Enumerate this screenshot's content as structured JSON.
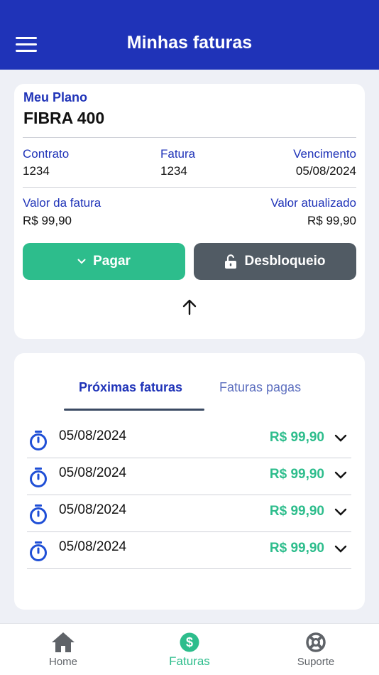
{
  "header": {
    "title": "Minhas faturas",
    "menu_icon": "menu-icon"
  },
  "plan": {
    "label": "Meu Plano",
    "name": "FIBRA 400",
    "contrato_label": "Contrato",
    "contrato_value": "1234",
    "fatura_label": "Fatura",
    "fatura_value": "1234",
    "vencimento_label": "Vencimento",
    "vencimento_value": "05/08/2024",
    "valor_label": "Valor da fatura",
    "valor_value": "R$ 99,90",
    "atualizado_label": "Valor atualizado",
    "atualizado_value": "R$ 99,90"
  },
  "actions": {
    "pagar_label": "Pagar",
    "desbloqueio_label": "Desbloqueio"
  },
  "tabs": {
    "active_label": "Próximas faturas",
    "inactive_label": "Faturas pagas"
  },
  "invoices": [
    {
      "date": "05/08/2024",
      "amount": "R$ 99,90"
    },
    {
      "date": "05/08/2024",
      "amount": "R$ 99,90"
    },
    {
      "date": "05/08/2024",
      "amount": "R$ 99,90"
    },
    {
      "date": "05/08/2024",
      "amount": "R$ 99,90"
    }
  ],
  "bottom_nav": {
    "home_label": "Home",
    "faturas_label": "Faturas",
    "suporte_label": "Suporte"
  },
  "colors": {
    "primary": "#1f33b8",
    "accent_green": "#2dbd8c",
    "dark_button": "#515b64",
    "background": "#eef0f6"
  }
}
